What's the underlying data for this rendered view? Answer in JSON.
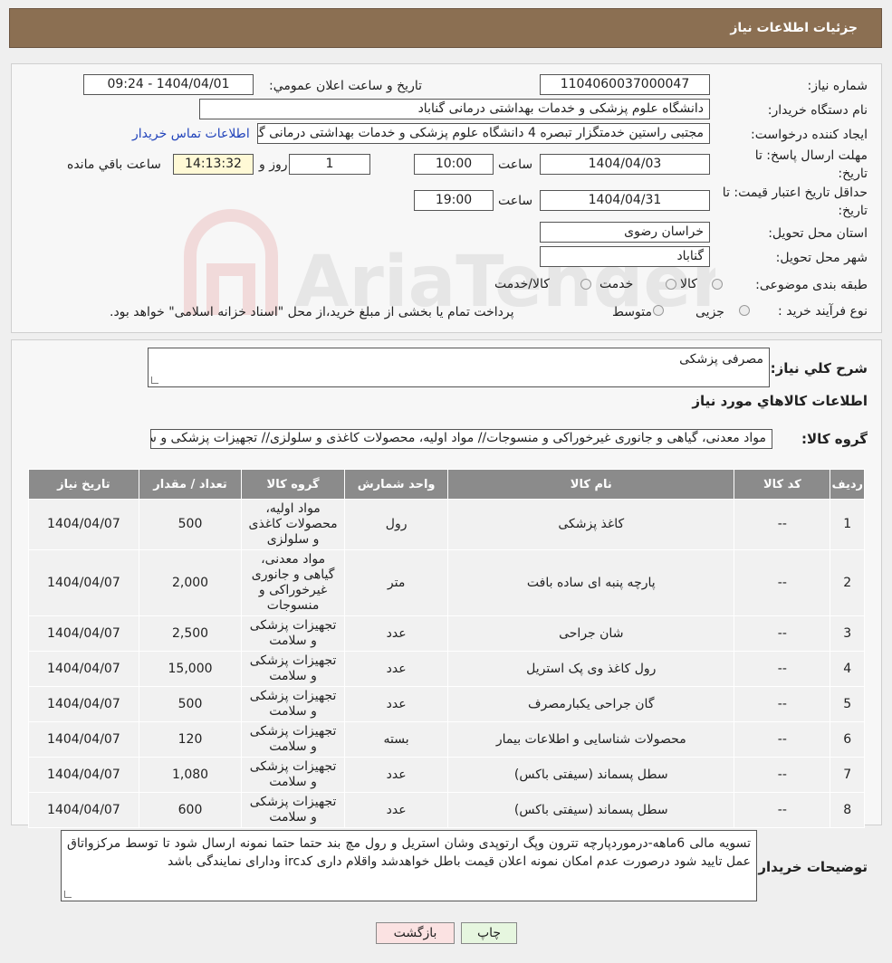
{
  "header": {
    "title": "جزئیات اطلاعات نیاز"
  },
  "watermark": {
    "text": "AriaTender.neT"
  },
  "form": {
    "need_number": {
      "label": "شماره نیاز:",
      "value": "1104060037000047"
    },
    "announce_datetime": {
      "label": "تاریخ و ساعت اعلان عمومي:",
      "value": "1404/04/01 - 09:24"
    },
    "buyer_org": {
      "label": "نام دستگاه خریدار:",
      "value": "دانشگاه علوم پزشکی و خدمات بهداشتی درمانی گناباد"
    },
    "requester": {
      "label": "ایجاد کننده درخواست:",
      "value": "مجتبی راستین خدمتگزار تبصره 4 دانشگاه علوم پزشکی و خدمات بهداشتی درمانی گناباد",
      "contact_link": "اطلاعات تماس خریدار"
    },
    "response_deadline": {
      "label": "مهلت ارسال پاسخ: تا تاریخ:",
      "date": "1404/04/03",
      "time_label": "ساعت",
      "time": "10:00",
      "days": "1",
      "days_label": "روز و",
      "remaining": "14:13:32",
      "remaining_label": "ساعت باقي مانده"
    },
    "price_validity": {
      "label": "حداقل تاریخ اعتبار قیمت: تا تاریخ:",
      "date": "1404/04/31",
      "time_label": "ساعت",
      "time": "19:00"
    },
    "province": {
      "label": "استان محل تحویل:",
      "value": "خراسان رضوی"
    },
    "city": {
      "label": "شهر محل تحویل:",
      "value": "گناباد"
    },
    "category": {
      "label": "طبقه بندی موضوعی:",
      "options": [
        "کالا",
        "خدمت",
        "کالا/خدمت"
      ]
    },
    "purchase_type": {
      "label": "نوع فرآیند خرید :",
      "options": [
        "جزیی",
        "متوسط"
      ],
      "note": "پرداخت تمام یا بخشی از مبلغ خرید،از محل \"اسناد خزانه اسلامی\" خواهد بود."
    }
  },
  "details": {
    "general_desc_label": "شرح کلي نیاز:",
    "general_desc": "مصرفی پزشکی",
    "goods_info_title": "اطلاعات کالاهاي مورد نیاز",
    "goods_group_label": "گروه کالا:",
    "goods_group_value": "مواد معدنی، گیاهی و جانوری غیرخوراکی و منسوجات// مواد اولیه، محصولات کاغذی و سلولزی// تجهیزات پزشکی و سلامت"
  },
  "table": {
    "headers": [
      "ردیف",
      "کد کالا",
      "نام کالا",
      "واحد شمارش",
      "گروه کالا",
      "تعداد / مقدار",
      "تاریخ نیاز"
    ],
    "rows": [
      [
        "1",
        "--",
        "کاغذ پزشکی",
        "رول",
        "مواد اولیه، محصولات کاغذی و سلولزی",
        "500",
        "1404/04/07"
      ],
      [
        "2",
        "--",
        "پارچه پنبه ای ساده بافت",
        "متر",
        "مواد معدنی، گیاهی و جانوری غیرخوراکی و منسوجات",
        "2,000",
        "1404/04/07"
      ],
      [
        "3",
        "--",
        "شان جراحی",
        "عدد",
        "تجهیزات پزشکی و سلامت",
        "2,500",
        "1404/04/07"
      ],
      [
        "4",
        "--",
        "رول کاغذ وی پک استریل",
        "عدد",
        "تجهیزات پزشکی و سلامت",
        "15,000",
        "1404/04/07"
      ],
      [
        "5",
        "--",
        "گان جراحی یکبارمصرف",
        "عدد",
        "تجهیزات پزشکی و سلامت",
        "500",
        "1404/04/07"
      ],
      [
        "6",
        "--",
        "محصولات شناسایی و اطلاعات بیمار",
        "بسته",
        "تجهیزات پزشکی و سلامت",
        "120",
        "1404/04/07"
      ],
      [
        "7",
        "--",
        "سطل پسماند (سیفتی باکس)",
        "عدد",
        "تجهیزات پزشکی و سلامت",
        "1,080",
        "1404/04/07"
      ],
      [
        "8",
        "--",
        "سطل پسماند (سیفتی باکس)",
        "عدد",
        "تجهیزات پزشکی و سلامت",
        "600",
        "1404/04/07"
      ]
    ]
  },
  "buyer_notes": {
    "label": "توضیحات خریدار:",
    "text": "تسویه مالی 6ماهه-درموردپارچه تترون وپگ ارتوپدی وشان استریل و رول مچ بند حتما حتما نمونه ارسال شود تا توسط مرکزواتاق عمل تایید شود درصورت عدم امکان نمونه اعلان قیمت باطل خواهدشد واقلام داری کدirc ودارای نمایندگی باشد"
  },
  "buttons": {
    "print": "چاپ",
    "back": "بازگشت"
  },
  "colors": {
    "header_bg": "#8b6f52",
    "table_header_bg": "#8b8b8b",
    "link": "#2244bb",
    "print_btn": "#e6f6df",
    "back_btn": "#fbe2e2"
  }
}
